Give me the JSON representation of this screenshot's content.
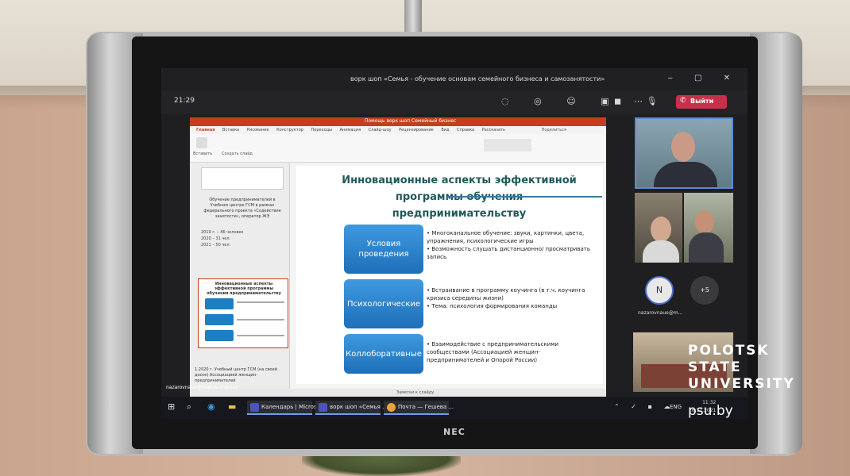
{
  "window": {
    "title": "ворк шоп «Семья - обучение основам семейного бизнеса и самозанятости»",
    "controls": "‒ ▢ ✕",
    "timer": "21:29"
  },
  "call": {
    "icons": [
      "chat-icon",
      "participants-icon",
      "reactions-icon",
      "rooms-icon",
      "more-icon"
    ],
    "icons_glyph": "◌ ◎ ☺ ▣ ⋯",
    "media_glyph": "◼ 🎙 ⬆",
    "leave_label": "Выйти"
  },
  "ppt": {
    "window_title": "Помощь ворк шоп Семейный бизнес",
    "tabs": [
      "Главная",
      "Вставка",
      "Рисование",
      "Конструктор",
      "Переходы",
      "Анимация",
      "Слайд-шоу",
      "Рецензирование",
      "Вид",
      "Справка",
      "Рассказать"
    ],
    "share_label": "Поделиться",
    "ribbon_paste": "Вставить",
    "ribbon_new_slide": "Создать слайд",
    "thumb_text": "Обучение предпринимателей в Учебном центре ГСМ в рамках федерального проекта «Содействие занятости», оператор ЖЭ",
    "thumb_list": [
      "2019 г. – 46 человек",
      "2020 – 31 чел.",
      "2021 – 50 чел."
    ],
    "thumb2_title": "Инновационные аспекты эффективной программы обучения предпринимательству",
    "thumb_foot": "1.2020 г. Учебный центр ГСМ (на своей доске) Ассоциацией женщин-предпринимателей",
    "notes_placeholder": "Заметки к слайду"
  },
  "slide": {
    "title_lines": [
      "Инновационные аспекты эффективной",
      "программы обучения",
      "предпринимательству"
    ],
    "rows": [
      {
        "box": "Условия проведения",
        "bullets": [
          "Многоканальное обучение: звуки, картинки, цвета, упражнения, психологические игры",
          "Возможность слушать дистанционно/ просматривать запись"
        ]
      },
      {
        "box": "Психологические",
        "bullets": [
          "Встраивание в программу коучинга (в т.ч. коучинга кризиса середины жизни)",
          "Тема: психология формирования команды"
        ]
      },
      {
        "box": "Коллоборативные",
        "bullets": [
          "Взаимодействие с предпринимательскими сообществами (Ассоциацией женщин-предпринимателей и Опорой России)"
        ]
      }
    ]
  },
  "participants": {
    "avatar_letter": "N",
    "more_count": "+5",
    "name": "nazarovnaue@m...",
    "local_label": "nazarovnaue@mail.ru (гость)"
  },
  "taskbar": {
    "apps": [
      {
        "label": "Календарь | Micros...",
        "color": "#4b53bc"
      },
      {
        "label": "ворк шоп «Семья ...",
        "color": "#4b53bc"
      },
      {
        "label": "Почта — Гешева ...",
        "color": "#e8a33a"
      }
    ],
    "lang": "ENG",
    "time": "11:32",
    "date": "26.11.2021"
  },
  "device": {
    "brand": "NEC"
  },
  "watermark": {
    "lines": [
      "POLOTSK",
      "STATE",
      "UNIVERSITY"
    ],
    "site": "psu.by"
  }
}
